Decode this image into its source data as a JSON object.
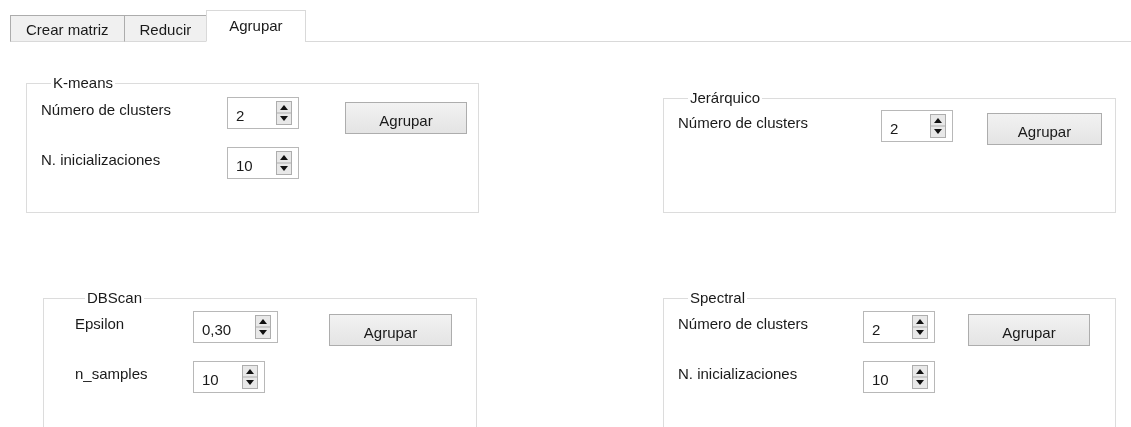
{
  "tabs": [
    {
      "label": "Crear matriz",
      "selected": false
    },
    {
      "label": "Reducir",
      "selected": false
    },
    {
      "label": "Agrupar",
      "selected": true
    }
  ],
  "groups": [
    {
      "title": "K-means",
      "rows": [
        {
          "label": "Número de clusters",
          "value": "2"
        },
        {
          "label": "N. inicializaciones",
          "value": "10"
        }
      ],
      "button": "Agrupar"
    },
    {
      "title": "Jerárquico",
      "rows": [
        {
          "label": "Número de clusters",
          "value": "2"
        }
      ],
      "button": "Agrupar"
    },
    {
      "title": "DBScan",
      "rows": [
        {
          "label": "Epsilon",
          "value": "0,30"
        },
        {
          "label": "n_samples",
          "value": "10"
        }
      ],
      "button": "Agrupar"
    },
    {
      "title": "Spectral",
      "rows": [
        {
          "label": "Número de clusters",
          "value": "2"
        },
        {
          "label": "N. inicializaciones",
          "value": "10"
        }
      ],
      "button": "Agrupar"
    }
  ]
}
